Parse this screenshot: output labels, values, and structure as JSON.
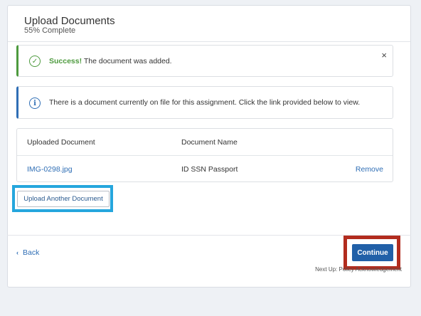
{
  "header": {
    "title": "Upload Documents",
    "progress": "55% Complete"
  },
  "success_alert": {
    "strong": "Success!",
    "message": " The document was added.",
    "close_symbol": "×"
  },
  "info_alert": {
    "message": "There is a document currently on file for this assignment. Click the link provided below to view."
  },
  "documents_table": {
    "headers": [
      "Uploaded Document",
      "Document Name"
    ],
    "rows": [
      {
        "file": "IMG-0298.jpg",
        "name": "ID SSN Passport",
        "action": "Remove"
      }
    ]
  },
  "upload_button_label": "Upload Another Document",
  "footer": {
    "back_label": "Back",
    "continue_label": "Continue",
    "next_up": "Next Up: Policy Acknowledgement"
  },
  "colors": {
    "success": "#4d9a3e",
    "info": "#2f6eb5",
    "primary_button": "#2160a8",
    "highlight_blue": "#25a6dd",
    "highlight_red": "#b22c1e"
  },
  "icons": {
    "success": "check-circle-icon",
    "info": "info-circle-icon",
    "back": "chevron-left-icon"
  }
}
